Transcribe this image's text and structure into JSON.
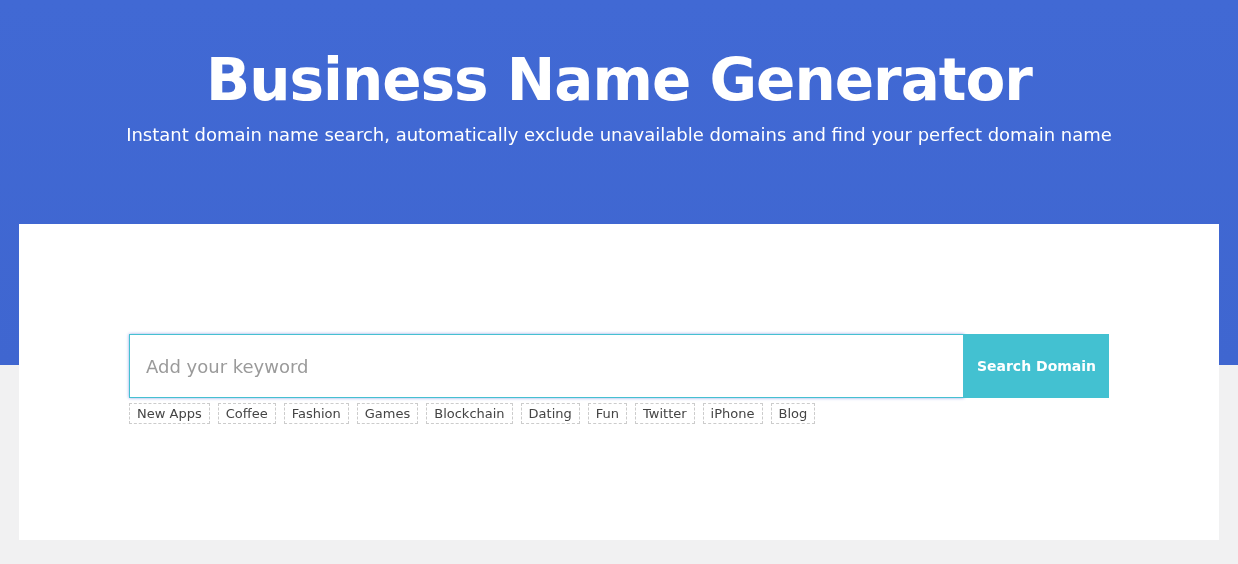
{
  "hero": {
    "title": "Business Name Generator",
    "subtitle": "Instant domain name search, automatically exclude unavailable domains and find your perfect domain name"
  },
  "search": {
    "placeholder": "Add your keyword",
    "button": "Search Domain"
  },
  "suggestions": [
    "New Apps",
    "Coffee",
    "Fashion",
    "Games",
    "Blockchain",
    "Dating",
    "Fun",
    "Twitter",
    "iPhone",
    "Blog"
  ]
}
